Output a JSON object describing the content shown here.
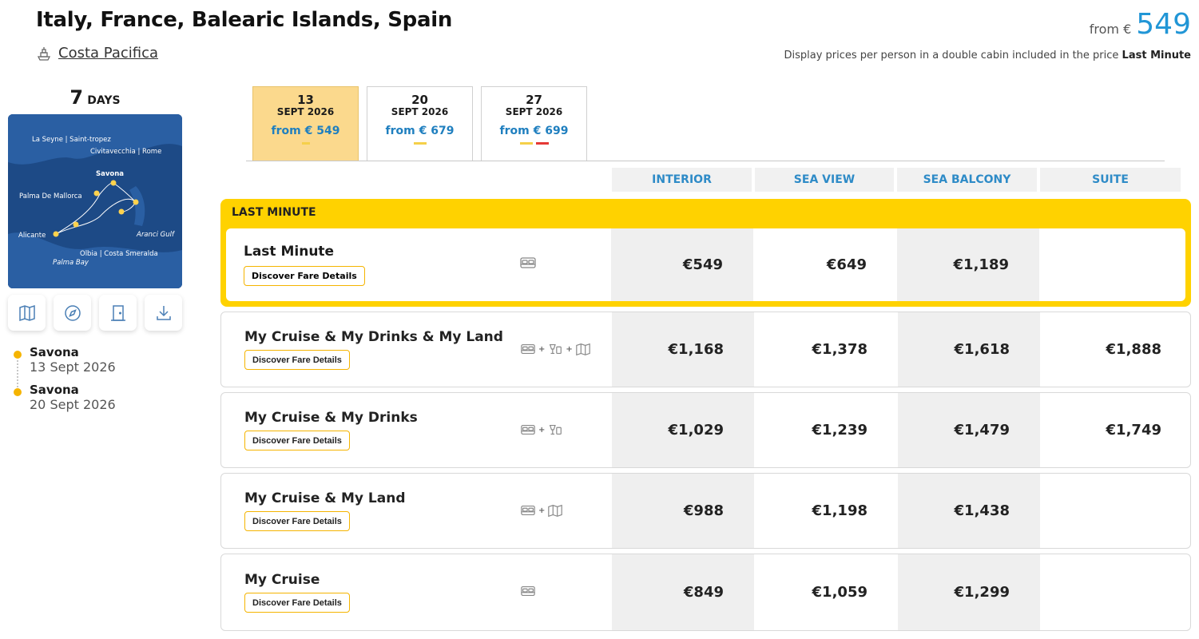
{
  "header": {
    "title": "Italy, France, Balearic Islands, Spain",
    "ship_name": "Costa Pacifica",
    "from_label": "from €",
    "from_price": "549",
    "disclaimer_text": "Display prices per person in a double cabin included in the price",
    "disclaimer_bold": "Last Minute"
  },
  "duration": {
    "number": "7",
    "unit": "DAYS"
  },
  "map": {
    "labels": [
      "La Seyne | Saint-tropez",
      "Civitavecchia | Rome",
      "Savona",
      "Palma De Mallorca",
      "Alicante",
      "Aranci Gulf",
      "Olbia | Costa Smeralda",
      "Palma Bay"
    ]
  },
  "tools": [
    "map-icon",
    "compass-icon",
    "door-icon",
    "download-icon"
  ],
  "itinerary": [
    {
      "city": "Savona",
      "date": "13 Sept 2026"
    },
    {
      "city": "Savona",
      "date": "20 Sept 2026"
    }
  ],
  "dates": [
    {
      "day": "13",
      "month": "SEPT 2026",
      "price": "from € 549",
      "active": true
    },
    {
      "day": "20",
      "month": "SEPT 2026",
      "price": "from € 679",
      "active": false
    },
    {
      "day": "27",
      "month": "SEPT 2026",
      "price": "from € 699",
      "active": false
    }
  ],
  "columns": [
    "INTERIOR",
    "SEA VIEW",
    "SEA BALCONY",
    "SUITE"
  ],
  "last_minute_label": "LAST MINUTE",
  "fare_button_label": "Discover Fare Details",
  "fares": [
    {
      "name": "Last Minute",
      "icons": [
        "bed-icon"
      ],
      "prices": [
        "€549",
        "€649",
        "€1,189",
        ""
      ]
    },
    {
      "name": "My Cruise & My Drinks & My Land",
      "icons": [
        "bed-icon",
        "drinks-icon",
        "land-map-icon"
      ],
      "prices": [
        "€1,168",
        "€1,378",
        "€1,618",
        "€1,888"
      ]
    },
    {
      "name": "My Cruise & My Drinks",
      "icons": [
        "bed-icon",
        "drinks-icon"
      ],
      "prices": [
        "€1,029",
        "€1,239",
        "€1,479",
        "€1,749"
      ]
    },
    {
      "name": "My Cruise & My Land",
      "icons": [
        "bed-icon",
        "land-map-icon"
      ],
      "prices": [
        "€988",
        "€1,198",
        "€1,438",
        ""
      ]
    },
    {
      "name": "My Cruise",
      "icons": [
        "bed-icon"
      ],
      "prices": [
        "€849",
        "€1,059",
        "€1,299",
        ""
      ]
    }
  ],
  "colors": {
    "accent_yellow": "#ffd200",
    "price_blue": "#2196d6",
    "tab_active": "#fbd98d"
  }
}
